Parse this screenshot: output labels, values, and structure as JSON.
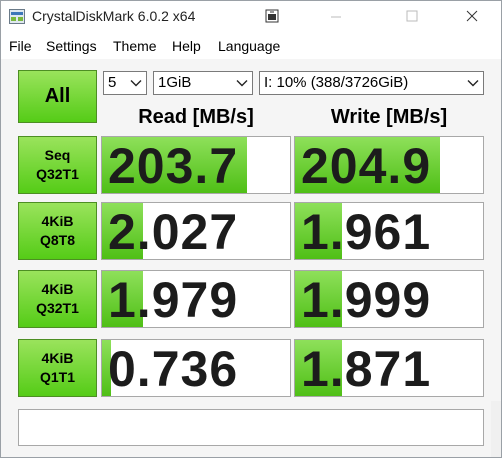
{
  "window": {
    "title": "CrystalDiskMark 6.0.2 x64"
  },
  "menu": [
    "File",
    "Settings",
    "Theme",
    "Help",
    "Language"
  ],
  "controls": {
    "all_label": "All",
    "count": "5",
    "size": "1GiB",
    "drive": "I: 10% (388/3726GiB)"
  },
  "headers": {
    "read": "Read [MB/s]",
    "write": "Write [MB/s]"
  },
  "tests": [
    {
      "line1": "Seq",
      "line2": "Q32T1",
      "read": "203.7",
      "write": "204.9",
      "read_fill": 0.77,
      "write_fill": 0.77
    },
    {
      "line1": "4KiB",
      "line2": "Q8T8",
      "read": "2.027",
      "write": "1.961",
      "read_fill": 0.22,
      "write_fill": 0.25
    },
    {
      "line1": "4KiB",
      "line2": "Q32T1",
      "read": "1.979",
      "write": "1.999",
      "read_fill": 0.22,
      "write_fill": 0.25
    },
    {
      "line1": "4KiB",
      "line2": "Q1T1",
      "read": "0.736",
      "write": "1.871",
      "read_fill": 0.05,
      "write_fill": 0.25
    }
  ],
  "comment": "",
  "colors": {
    "accent_green": "#55cc17",
    "accent_green_light": "#9ae35c"
  },
  "icons": [
    "app-icon",
    "compact-view-icon",
    "minimize-icon",
    "maximize-icon",
    "close-icon",
    "chevron-down-icon"
  ]
}
